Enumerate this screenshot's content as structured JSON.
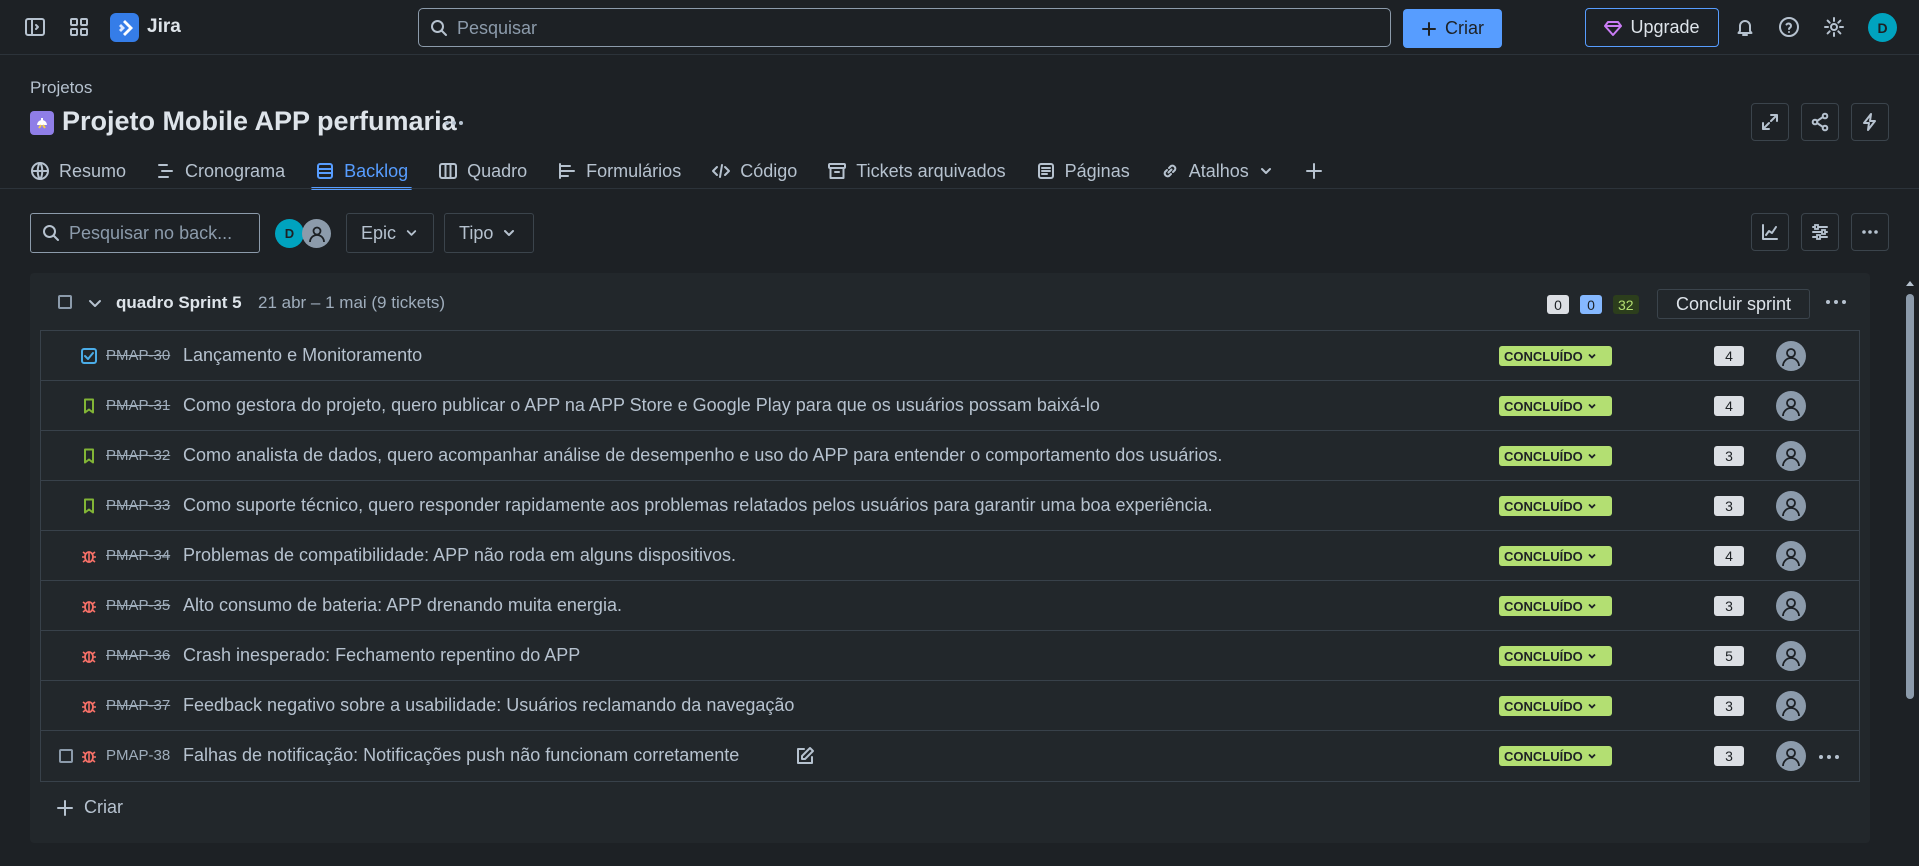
{
  "app": {
    "name": "Jira"
  },
  "topbar": {
    "search_placeholder": "Pesquisar",
    "create_label": "Criar",
    "upgrade_label": "Upgrade",
    "avatar_initial": "D"
  },
  "project": {
    "breadcrumb": "Projetos",
    "title": "Projeto Mobile APP perfumaria"
  },
  "tabs": [
    {
      "label": "Resumo",
      "icon": "globe-icon"
    },
    {
      "label": "Cronograma",
      "icon": "timeline-icon"
    },
    {
      "label": "Backlog",
      "icon": "backlog-icon",
      "active": true
    },
    {
      "label": "Quadro",
      "icon": "board-icon"
    },
    {
      "label": "Formulários",
      "icon": "forms-icon"
    },
    {
      "label": "Código",
      "icon": "code-icon"
    },
    {
      "label": "Tickets arquivados",
      "icon": "archive-icon"
    },
    {
      "label": "Páginas",
      "icon": "pages-icon"
    },
    {
      "label": "Atalhos",
      "icon": "link-icon"
    }
  ],
  "filters": {
    "search_placeholder": "Pesquisar no back...",
    "avatar_initial": "D",
    "epic_label": "Epic",
    "type_label": "Tipo"
  },
  "sprint": {
    "name": "quadro Sprint 5",
    "dates": "21 abr – 1 mai (9 tickets)",
    "points_todo": "0",
    "points_inprogress": "0",
    "points_done": "32",
    "conclude_label": "Concluir sprint",
    "create_label": "Criar"
  },
  "issues": [
    {
      "type": "task",
      "key": "PMAP-30",
      "done": true,
      "summary": "Lançamento e Monitoramento",
      "status": "CONCLUÍDO",
      "estimate": "4"
    },
    {
      "type": "story",
      "key": "PMAP-31",
      "done": true,
      "summary": "Como gestora do projeto, quero publicar o APP na APP Store e Google Play para que os usuários possam baixá-lo",
      "status": "CONCLUÍDO",
      "estimate": "4"
    },
    {
      "type": "story",
      "key": "PMAP-32",
      "done": true,
      "summary": "Como analista de dados, quero acompanhar análise de desempenho e uso do APP para entender o comportamento dos usuários.",
      "status": "CONCLUÍDO",
      "estimate": "3"
    },
    {
      "type": "story",
      "key": "PMAP-33",
      "done": true,
      "summary": "Como suporte técnico, quero responder rapidamente aos problemas relatados pelos usuários para garantir uma boa experiência.",
      "status": "CONCLUÍDO",
      "estimate": "3"
    },
    {
      "type": "bug",
      "key": "PMAP-34",
      "done": true,
      "summary": "Problemas de compatibilidade: APP não roda em alguns dispositivos.",
      "status": "CONCLUÍDO",
      "estimate": "4"
    },
    {
      "type": "bug",
      "key": "PMAP-35",
      "done": true,
      "summary": "Alto consumo de bateria: APP drenando muita energia.",
      "status": "CONCLUÍDO",
      "estimate": "3"
    },
    {
      "type": "bug",
      "key": "PMAP-36",
      "done": true,
      "summary": "Crash inesperado: Fechamento repentino do APP",
      "status": "CONCLUÍDO",
      "estimate": "5"
    },
    {
      "type": "bug",
      "key": "PMAP-37",
      "done": true,
      "summary": "Feedback negativo sobre a usabilidade: Usuários reclamando da navegação",
      "status": "CONCLUÍDO",
      "estimate": "3"
    },
    {
      "type": "bug",
      "key": "PMAP-38",
      "done": false,
      "summary": "Falhas de notificação: Notificações push não funcionam corretamente",
      "status": "CONCLUÍDO",
      "estimate": "3"
    }
  ],
  "colors": {
    "background": "#1d2125",
    "accent": "#579dff",
    "done_status": "#b3df72",
    "bug": "#f87168",
    "story": "#82b536",
    "task": "#4bade8"
  }
}
